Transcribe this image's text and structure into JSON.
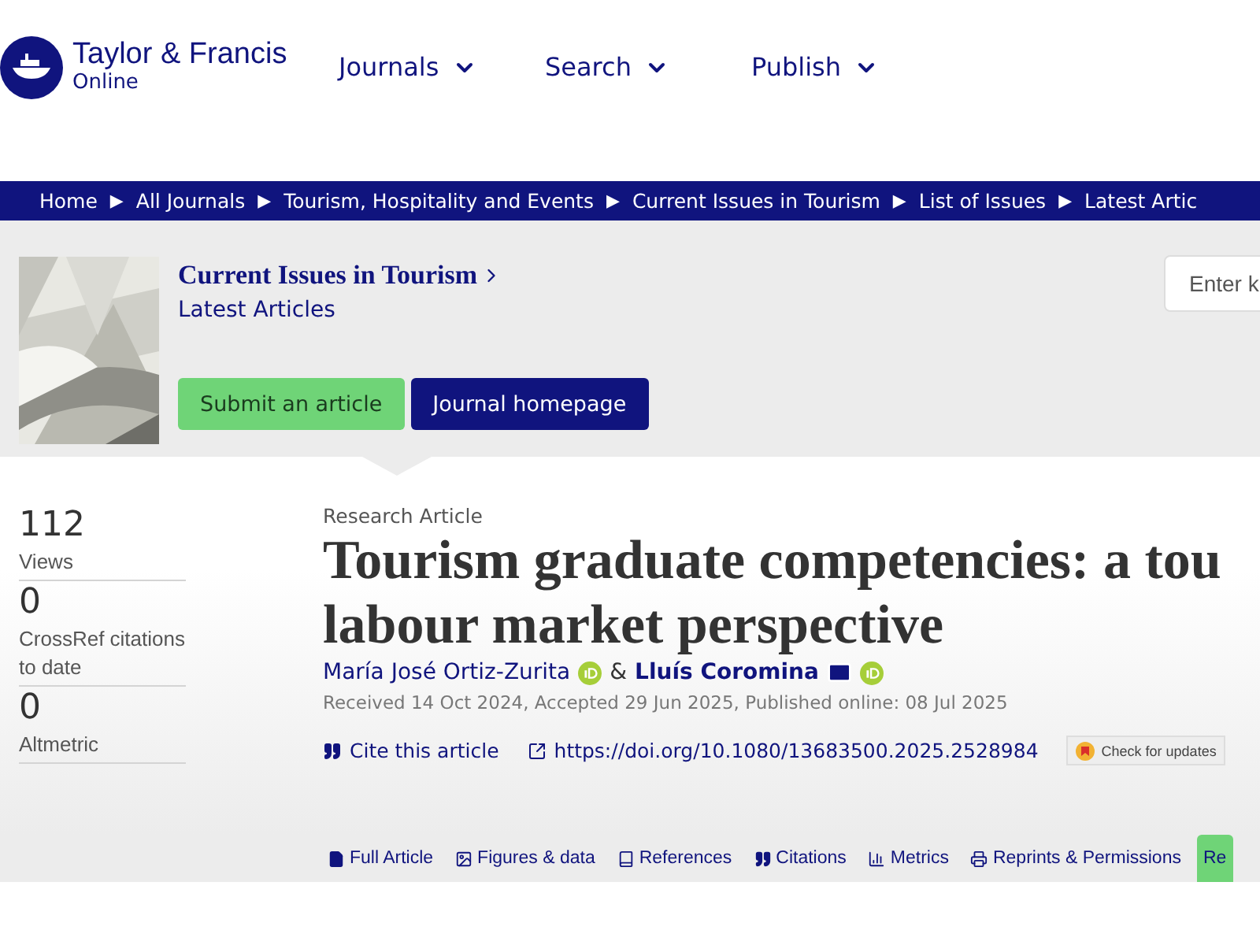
{
  "header": {
    "logo": {
      "name": "Taylor & Francis",
      "sub": "Online"
    },
    "menu": [
      {
        "label": "Journals"
      },
      {
        "label": "Search"
      },
      {
        "label": "Publish"
      }
    ]
  },
  "breadcrumb_separator": "▶",
  "breadcrumbs": [
    "Home",
    "All Journals",
    "Tourism, Hospitality and Events",
    "Current Issues in Tourism",
    "List of Issues",
    "Latest Artic"
  ],
  "journal": {
    "title": "Current Issues in Tourism",
    "subtitle": "Latest Articles",
    "buttons": [
      {
        "label": "Submit an article",
        "kind": "primary"
      },
      {
        "label": "Journal homepage",
        "kind": "secondary"
      }
    ],
    "search": {
      "placeholder": "Enter k"
    }
  },
  "metrics": [
    {
      "value": "112",
      "label": "Views"
    },
    {
      "value": "0",
      "label": "CrossRef citations to date"
    },
    {
      "value": "0",
      "label": "Altmetric"
    }
  ],
  "article": {
    "type": "Research Article",
    "title_lines": [
      "Tourism graduate competencies: a tou",
      "labour market perspective"
    ],
    "authors": [
      {
        "name": "María José Ortiz-Zurita",
        "bold": false,
        "email": false,
        "orcid": true
      },
      {
        "name": "Lluís Coromina",
        "bold": true,
        "email": true,
        "orcid": true
      }
    ],
    "author_separator": "&",
    "dates": "Received 14 Oct 2024, Accepted 29 Jun 2025, Published online: 08 Jul 2025",
    "cite": "Cite this article",
    "doi": "https://doi.org/10.1080/13683500.2025.2528984",
    "updates": "Check for updates"
  },
  "tabs": [
    {
      "label": "Full Article",
      "selected": false
    },
    {
      "label": "Figures & data",
      "selected": false
    },
    {
      "label": "References",
      "selected": false
    },
    {
      "label": "Citations",
      "selected": false
    },
    {
      "label": "Metrics",
      "selected": false
    },
    {
      "label": "Reprints & Permissions",
      "selected": false
    },
    {
      "label": "Re",
      "selected": true
    }
  ]
}
